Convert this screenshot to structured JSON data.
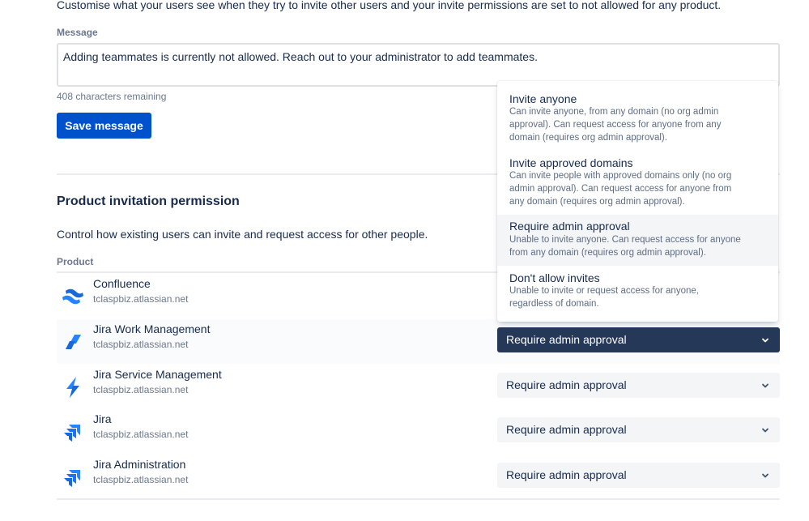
{
  "intro_text": "Customise what your users see when they try to invite other users and your invite permissions are set to not allowed for any product.",
  "message": {
    "label": "Message",
    "value": "Adding teammates is currently not allowed. Reach out to your administrator to add teammates.",
    "remaining": "408 characters remaining",
    "save_label": "Save message"
  },
  "permission": {
    "title": "Product invitation permission",
    "description": "Control how existing users can invite and request access for other people.",
    "column_header": "Product"
  },
  "products": [
    {
      "name": "Confluence",
      "url": "tclaspbiz.atlassian.net",
      "value": "Require admin approval",
      "icon": "confluence-icon"
    },
    {
      "name": "Jira Work Management",
      "url": "tclaspbiz.atlassian.net",
      "value": "Require admin approval",
      "icon": "jira-work-management-icon"
    },
    {
      "name": "Jira Service Management",
      "url": "tclaspbiz.atlassian.net",
      "value": "Require admin approval",
      "icon": "jira-service-management-icon"
    },
    {
      "name": "Jira",
      "url": "tclaspbiz.atlassian.net",
      "value": "Require admin approval",
      "icon": "jira-icon"
    },
    {
      "name": "Jira Administration",
      "url": "tclaspbiz.atlassian.net",
      "value": "Require admin approval",
      "icon": "jira-icon"
    }
  ],
  "dropdown_options": [
    {
      "title": "Invite anyone",
      "desc_lines": [
        "Can invite anyone, from any domain (no org admin",
        "approval). Can request access for anyone from any",
        "domain (requires org admin approval)."
      ]
    },
    {
      "title": "Invite approved domains",
      "desc_lines": [
        "Can invite people with approved domains only (no org",
        "admin approval). Can request access for anyone from",
        "any domain (requires org admin approval)."
      ]
    },
    {
      "title": "Require admin approval",
      "desc_lines": [
        "Unable to invite anyone. Can request access for anyone",
        "from any domain (requires org admin approval)."
      ]
    },
    {
      "title": "Don't allow invites",
      "desc_lines": [
        "Unable to invite or request access for anyone,",
        "regardless of domain."
      ]
    }
  ],
  "colors": {
    "primary_button": "#0052CC",
    "active_select": "#253858",
    "brand_blue": "#2684FF"
  }
}
